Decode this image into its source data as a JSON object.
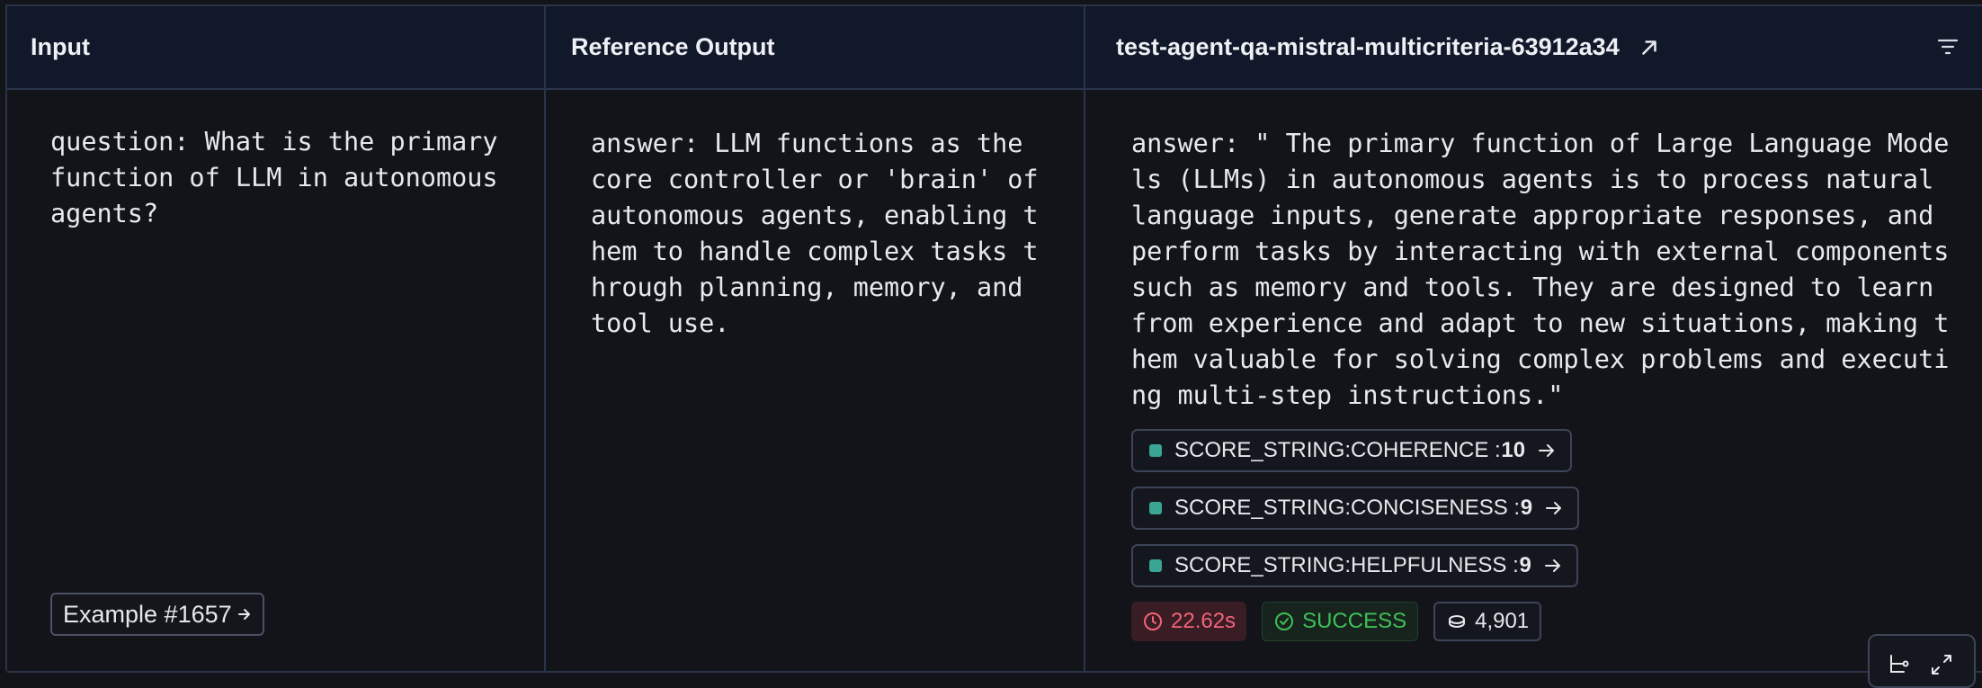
{
  "header": {
    "input_label": "Input",
    "reference_label": "Reference Output",
    "run_label": "test-agent-qa-mistral-multicriteria-63912a34"
  },
  "row": {
    "input_text": "question: What is the primary\nfunction of LLM in autonomous\nagents?",
    "reference_text": "answer: LLM functions as the\ncore controller or 'brain' of\nautonomous agents, enabling t\nhem to handle complex tasks t\nhrough planning, memory, and\ntool use.",
    "output_text": "answer: \" The primary function of Large Language Mode\nls (LLMs) in autonomous agents is to process natural\nlanguage inputs, generate appropriate responses, and\nperform tasks by interacting with external components\nsuch as memory and tools. They are designed to learn\nfrom experience and adapt to new situations, making t\nhem valuable for solving complex problems and executi\nng multi-step instructions.\"",
    "example_label": "Example #1657",
    "scores": [
      {
        "name": "SCORE_STRING:COHERENCE : ",
        "value": "10"
      },
      {
        "name": "SCORE_STRING:CONCISENESS : ",
        "value": "9"
      },
      {
        "name": "SCORE_STRING:HELPFULNESS : ",
        "value": "9"
      }
    ],
    "latency": "22.62s",
    "status": "SUCCESS",
    "tokens": "4,901"
  },
  "icons": {
    "external_link": "arrow-up-right-icon",
    "filter": "filter-lines-icon",
    "arrow": "arrow-right-icon",
    "clock": "clock-icon",
    "check": "check-circle-icon",
    "tokens": "coins-icon"
  },
  "colors": {
    "score_dot": "#3aa593",
    "latency": "#f2647a",
    "success": "#3fbf57"
  }
}
